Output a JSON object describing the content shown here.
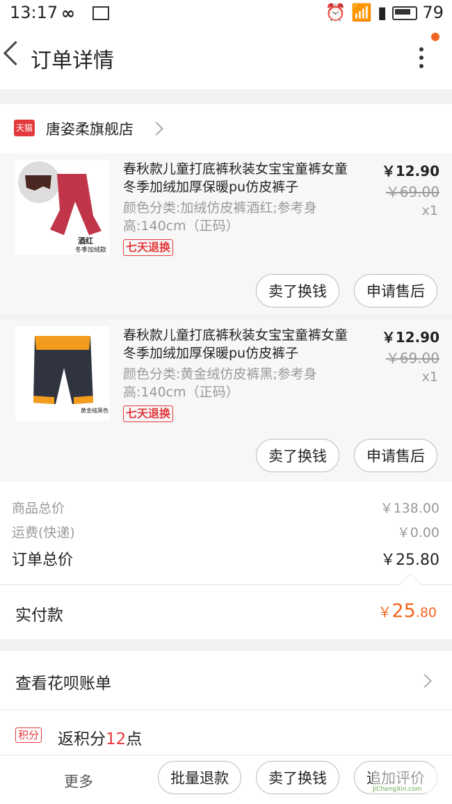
{
  "status_bar": {
    "time": "13:17",
    "battery": "79"
  },
  "nav": {
    "title": "订单详情"
  },
  "shop": {
    "badge": "天猫",
    "name": "唐姿柔旗舰店"
  },
  "items": [
    {
      "title": "春秋款儿童打底裤秋装女宝宝童裤女童冬季加绒加厚保暖pu仿皮裤子",
      "spec": "颜色分类:加绒仿皮裤酒红;参考身高:140cm（正码）",
      "badge": "七天退换",
      "price": "￥12.90",
      "orig_price": "￥69.00",
      "qty": "x1",
      "thumb_caption": "酒红",
      "thumb_sub": "冬季加绒款",
      "btn_sell": "卖了换钱",
      "btn_aftersale": "申请售后"
    },
    {
      "title": "春秋款儿童打底裤秋装女宝宝童裤女童冬季加绒加厚保暖pu仿皮裤子",
      "spec": "颜色分类:黄金绒仿皮裤黑;参考身高:140cm（正码）",
      "badge": "七天退换",
      "price": "￥12.90",
      "orig_price": "￥69.00",
      "qty": "x1",
      "thumb_caption": "黄金绒黑色",
      "btn_sell": "卖了换钱",
      "btn_aftersale": "申请售后"
    }
  ],
  "summary": {
    "goods_label": "商品总价",
    "goods_value": "￥138.00",
    "shipping_label": "运费(快递)",
    "shipping_value": "￥0.00",
    "order_label": "订单总价",
    "order_value": "￥25.80"
  },
  "paid": {
    "label": "实付款",
    "currency": "￥",
    "int": "25",
    "dec": ".80"
  },
  "huabei": {
    "label": "查看花呗账单"
  },
  "points": {
    "badge": "积分",
    "prefix": "返积分",
    "num": "12",
    "suffix": "点"
  },
  "bottom_bar": {
    "more": "更多",
    "batch_refund": "批量退款",
    "sell": "卖了换钱",
    "review": "追加评价"
  },
  "watermark": {
    "text": "JiChengXin.com"
  },
  "colors": {
    "accent": "#f26522",
    "tmall_red": "#e4393c"
  },
  "icons": [
    "back-icon",
    "more-icon",
    "tmall-icon",
    "chevron-right-icon"
  ]
}
